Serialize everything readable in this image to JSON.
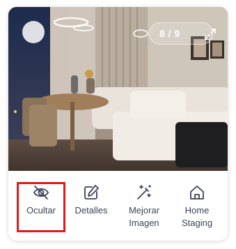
{
  "gallery": {
    "counter": "8 / 9",
    "icons": {
      "toggle": "circle-toggle-icon",
      "expand": "expand-arrows-icon"
    }
  },
  "actions": [
    {
      "label": "Ocultar",
      "icon": "eye-off-icon"
    },
    {
      "label": "Detalles",
      "icon": "edit-icon"
    },
    {
      "label": "Mejorar\nImagen",
      "icon": "magic-wand-icon"
    },
    {
      "label": "Home\nStaging",
      "icon": "home-icon"
    }
  ],
  "colors": {
    "highlight": "#e0191b",
    "icon": "#3a4453"
  }
}
